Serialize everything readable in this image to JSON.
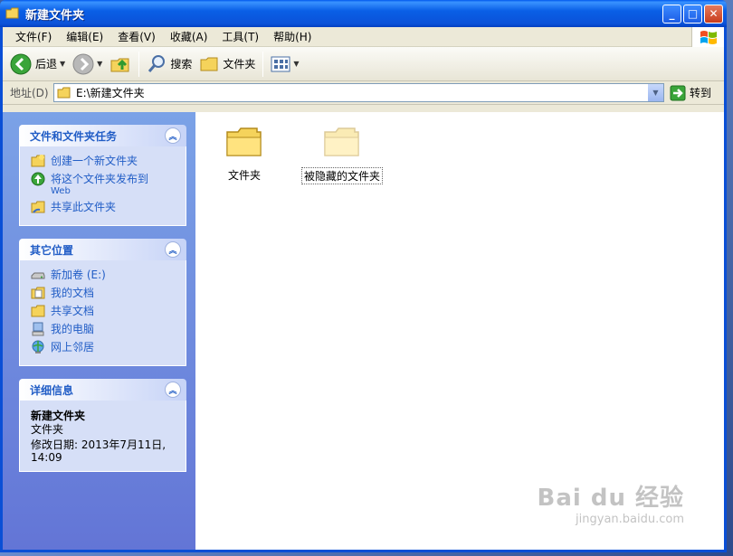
{
  "window": {
    "title": "新建文件夹",
    "min_label": "_",
    "max_label": "□",
    "close_label": "✕"
  },
  "menu": [
    {
      "label": "文件(F)"
    },
    {
      "label": "编辑(E)"
    },
    {
      "label": "查看(V)"
    },
    {
      "label": "收藏(A)"
    },
    {
      "label": "工具(T)"
    },
    {
      "label": "帮助(H)"
    }
  ],
  "toolbar": {
    "back_label": "后退",
    "search_label": "搜索",
    "folders_label": "文件夹"
  },
  "address": {
    "label": "地址(D)",
    "value": "E:\\新建文件夹",
    "go_label": "转到"
  },
  "tasks_panel": {
    "title": "文件和文件夹任务",
    "items": [
      {
        "label": "创建一个新文件夹",
        "icon": "new-folder-icon"
      },
      {
        "label": "将这个文件夹发布到",
        "sub": "Web",
        "icon": "publish-web-icon"
      },
      {
        "label": "共享此文件夹",
        "icon": "share-folder-icon"
      }
    ]
  },
  "places_panel": {
    "title": "其它位置",
    "items": [
      {
        "label": "新加卷 (E:)",
        "icon": "drive-icon"
      },
      {
        "label": "我的文档",
        "icon": "my-documents-icon"
      },
      {
        "label": "共享文档",
        "icon": "shared-documents-icon"
      },
      {
        "label": "我的电脑",
        "icon": "my-computer-icon"
      },
      {
        "label": "网上邻居",
        "icon": "network-places-icon"
      }
    ]
  },
  "details_panel": {
    "title": "详细信息",
    "name": "新建文件夹",
    "type": "文件夹",
    "modified": "修改日期: 2013年7月11日,",
    "time": "14:09"
  },
  "files": [
    {
      "label": "文件夹",
      "hidden": false
    },
    {
      "label": "被隐藏的文件夹",
      "hidden": true
    }
  ],
  "watermark": {
    "line1": "Bai du 经验",
    "line2": "jingyan.baidu.com"
  }
}
